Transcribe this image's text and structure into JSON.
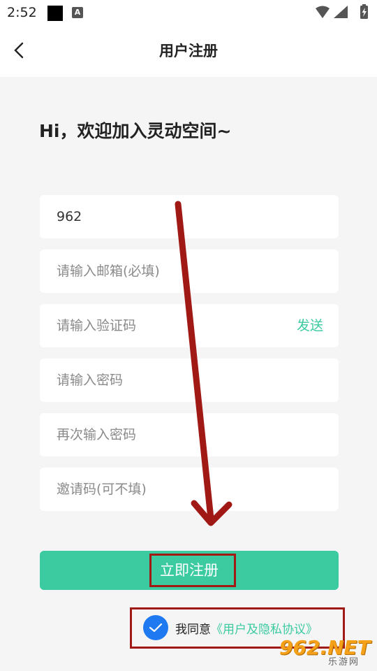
{
  "status_bar": {
    "time": "2:52",
    "app_badge": "A"
  },
  "header": {
    "title": "用户注册"
  },
  "welcome_text": "Hi，欢迎加入灵动空间~",
  "form": {
    "username": {
      "value": "962",
      "placeholder": ""
    },
    "email": {
      "value": "",
      "placeholder": "请输入邮箱(必填)"
    },
    "code": {
      "value": "",
      "placeholder": "请输入验证码",
      "send_label": "发送"
    },
    "password": {
      "value": "",
      "placeholder": "请输入密码"
    },
    "confirm_password": {
      "value": "",
      "placeholder": "再次输入密码"
    },
    "invite_code": {
      "value": "",
      "placeholder": "邀请码(可不填)"
    }
  },
  "submit_label": "立即注册",
  "agreement": {
    "text": "我同意",
    "link": "《用户及隐私协议》",
    "checked": true
  },
  "watermark": {
    "logo": "962.NET",
    "sub": "乐游网"
  },
  "colors": {
    "accent": "#3ccaa1",
    "check": "#1f79f0",
    "highlight": "#a11915"
  }
}
